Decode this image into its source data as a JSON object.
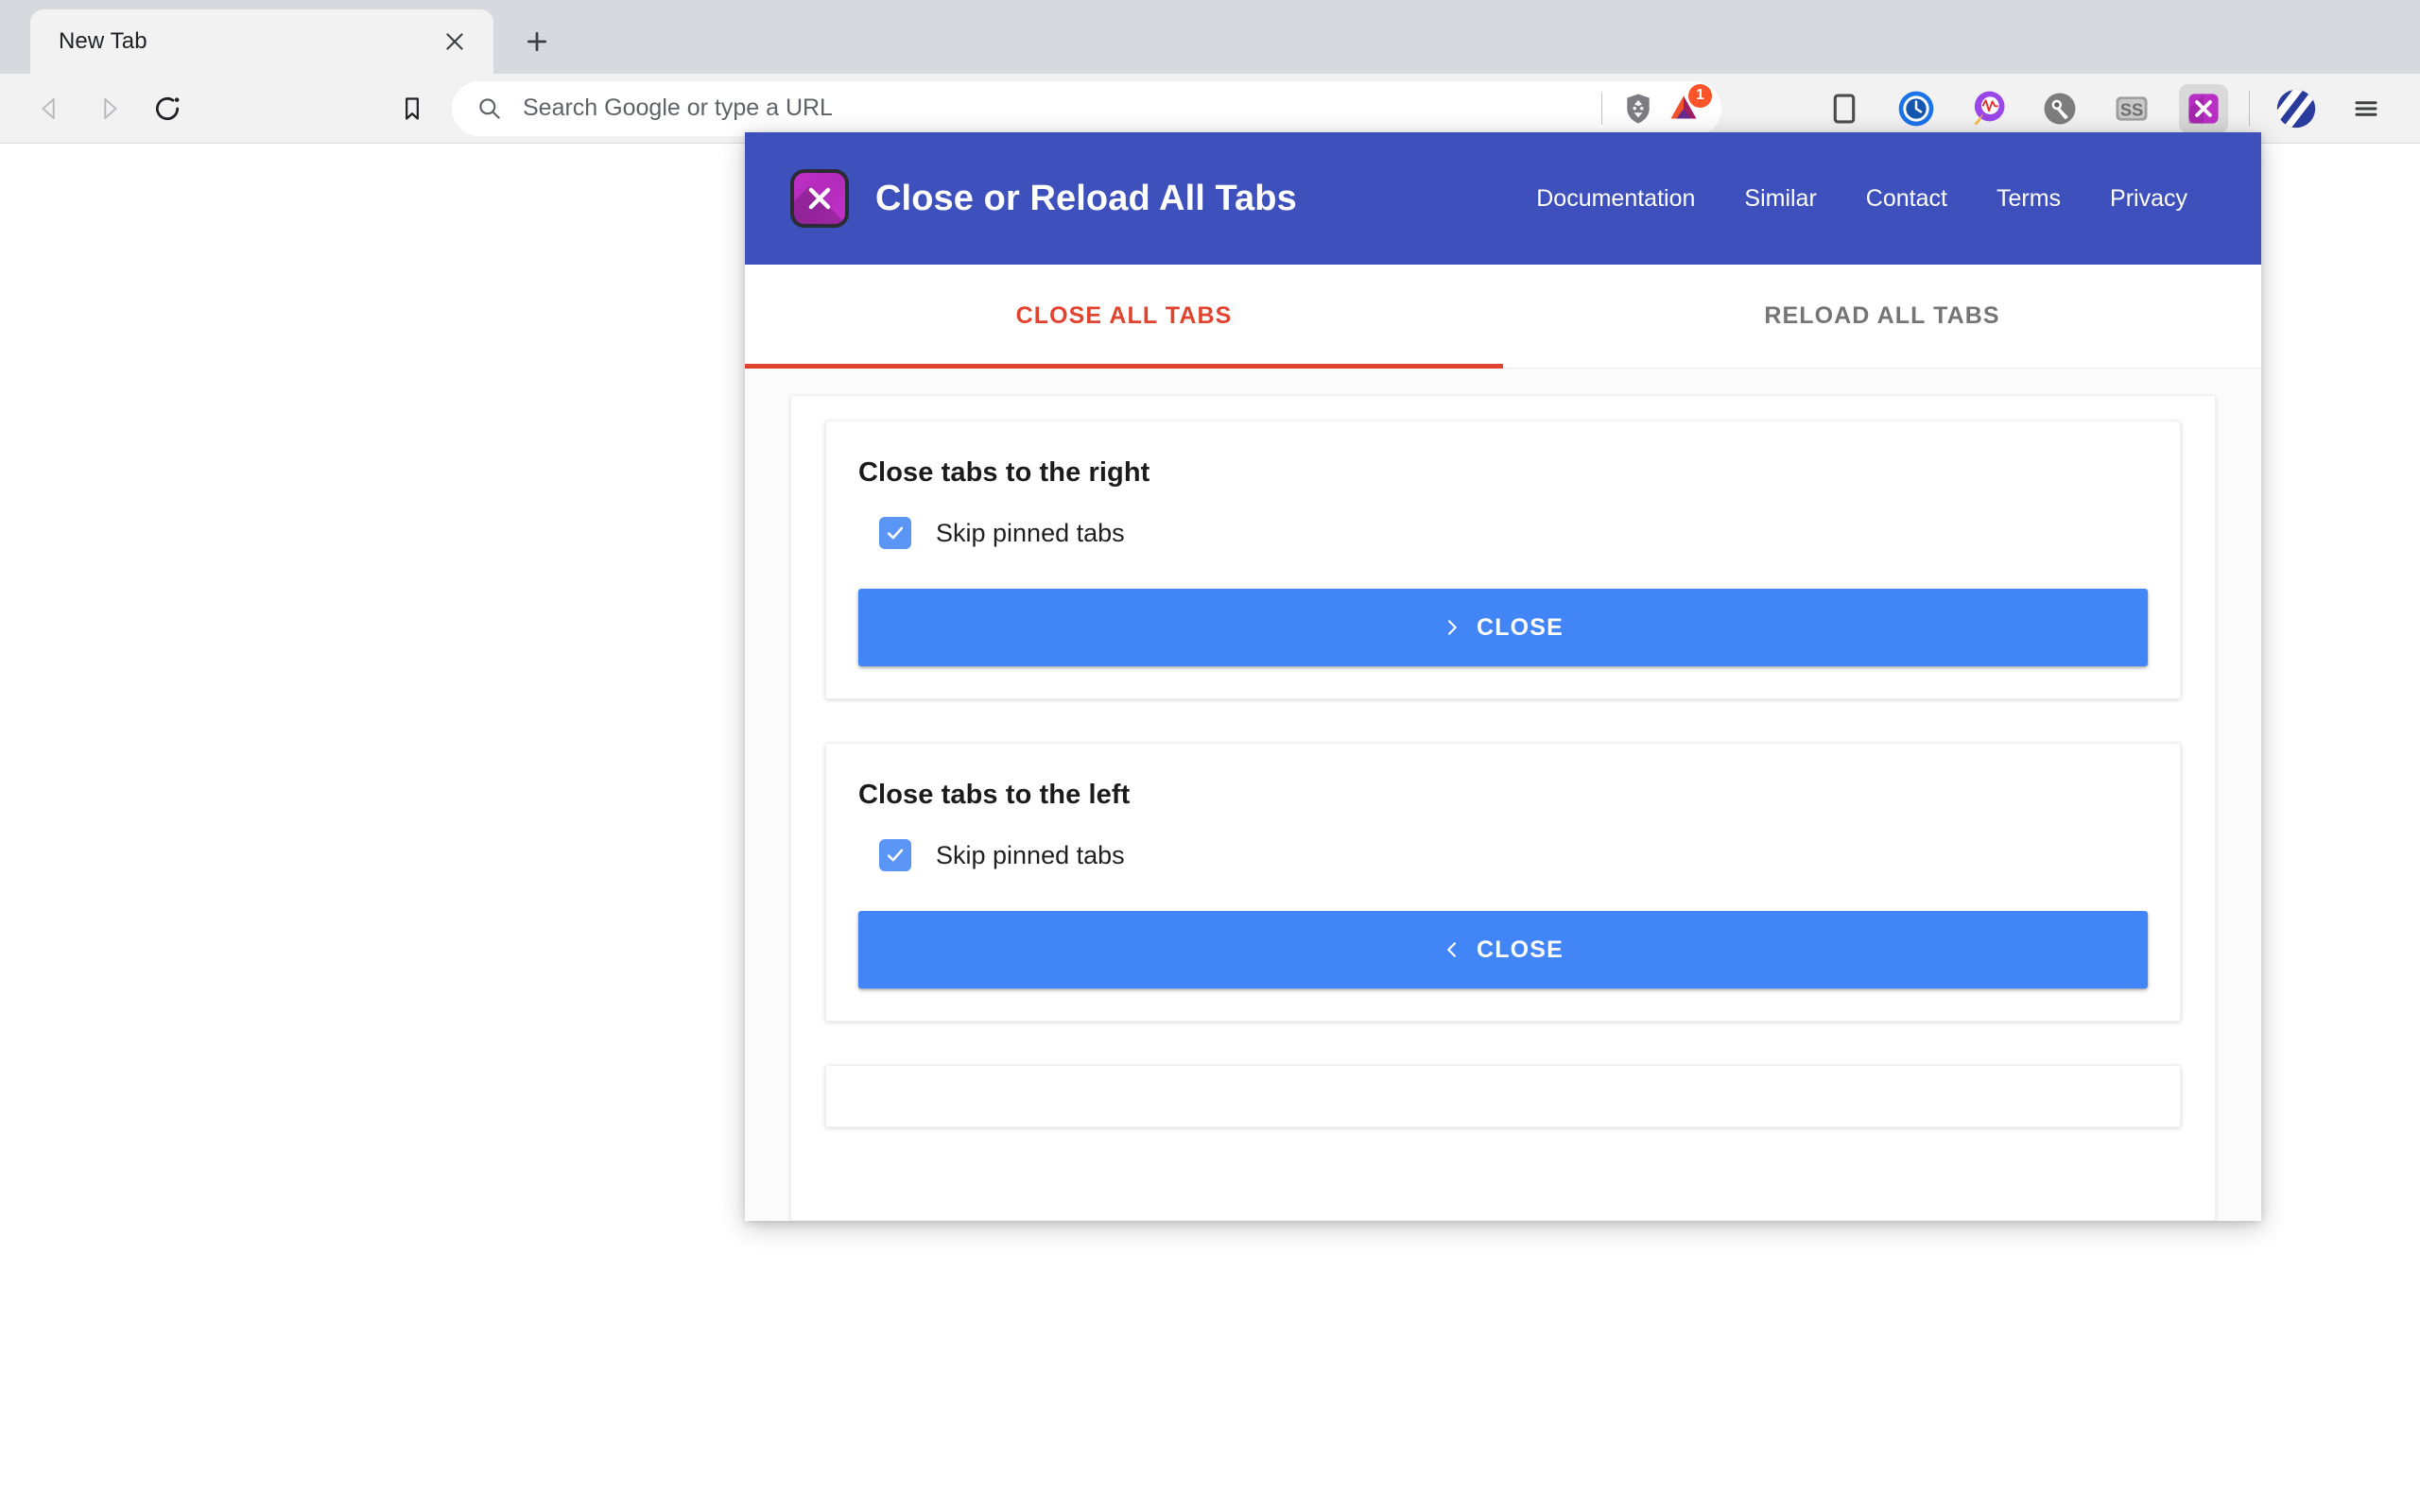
{
  "browser": {
    "tab": {
      "title": "New Tab",
      "close_icon": "close-icon"
    },
    "new_tab_icon": "plus-icon",
    "nav": {
      "back_icon": "back-arrow-icon",
      "forward_icon": "forward-arrow-icon",
      "reload_icon": "reload-icon",
      "bookmark_icon": "bookmark-icon"
    },
    "omnibox": {
      "search_icon": "search-icon",
      "value": "",
      "placeholder": "Search Google or type a URL"
    },
    "shields": {
      "brave_icon": "brave-lion-shield-icon",
      "bat_icon": "brave-rewards-triangle-icon",
      "bat_badge": "1"
    },
    "extensions": [
      {
        "name": "mobile-view-extension-icon",
        "active": false
      },
      {
        "name": "clock-extension-icon",
        "active": false
      },
      {
        "name": "magnifier-extension-icon",
        "active": false
      },
      {
        "name": "wrench-extension-icon",
        "active": false
      },
      {
        "name": "ss-extension-icon",
        "active": false
      },
      {
        "name": "close-or-reload-all-tabs-extension-icon",
        "active": true
      }
    ],
    "profile_icon": "profile-avatar-icon",
    "menu_icon": "hamburger-menu-icon"
  },
  "popup": {
    "header": {
      "logo_icon": "close-or-reload-all-tabs-logo-icon",
      "title": "Close or Reload All Tabs",
      "nav": [
        {
          "label": "Documentation"
        },
        {
          "label": "Similar"
        },
        {
          "label": "Contact"
        },
        {
          "label": "Terms"
        },
        {
          "label": "Privacy"
        }
      ]
    },
    "tabs": [
      {
        "label": "CLOSE ALL TABS",
        "active": true
      },
      {
        "label": "RELOAD ALL TABS",
        "active": false
      }
    ],
    "cards": [
      {
        "title": "Close tabs to the right",
        "checkbox_label": "Skip pinned tabs",
        "checked": true,
        "button_label": "CLOSE",
        "button_icon": "chevron-right-icon"
      },
      {
        "title": "Close tabs to the left",
        "checkbox_label": "Skip pinned tabs",
        "checked": true,
        "button_label": "CLOSE",
        "button_icon": "chevron-left-icon"
      }
    ],
    "colors": {
      "header_bg": "#3e50bc",
      "accent_tab": "#e2432f",
      "button_blue": "#4285f6",
      "checkbox_blue": "#5b95f5",
      "logo_purple": "#c02fc8",
      "badge_orange": "#fb542b"
    }
  }
}
